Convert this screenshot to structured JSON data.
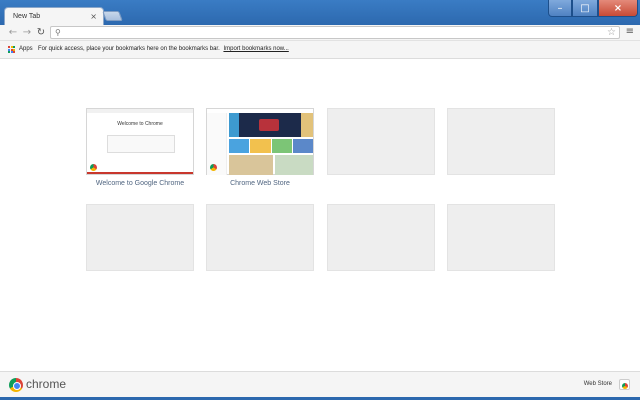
{
  "tab": {
    "title": "New Tab",
    "close_glyph": "×"
  },
  "window_controls": {
    "minimize": "–",
    "maximize": "□",
    "close": "×"
  },
  "toolbar": {
    "back_glyph": "←",
    "forward_glyph": "→",
    "reload_glyph": "↻",
    "search_glyph": "⚲",
    "star_glyph": "☆",
    "menu_glyph": "≡",
    "omnibox_value": ""
  },
  "bookmarks_bar": {
    "apps_label": "Apps",
    "hint": "For quick access, place your bookmarks here on the bookmarks bar.",
    "import_link": "Import bookmarks now..."
  },
  "apps_icon_colors": [
    "#db4437",
    "#f4b400",
    "#0f9d58",
    "#4285f4",
    "#db4437",
    "#f4b400",
    "#0f9d58",
    "#4285f4",
    "#db4437"
  ],
  "most_visited": [
    {
      "title": "Welcome to Google Chrome",
      "thumb_heading": "Welcome to Chrome"
    },
    {
      "title": "Chrome Web Store"
    }
  ],
  "footer": {
    "brand": "chrome",
    "webstore_label": "Web Store"
  },
  "colors": {
    "frame": "#2c68ae",
    "link": "#506580",
    "empty_tile": "#eeeeee"
  }
}
